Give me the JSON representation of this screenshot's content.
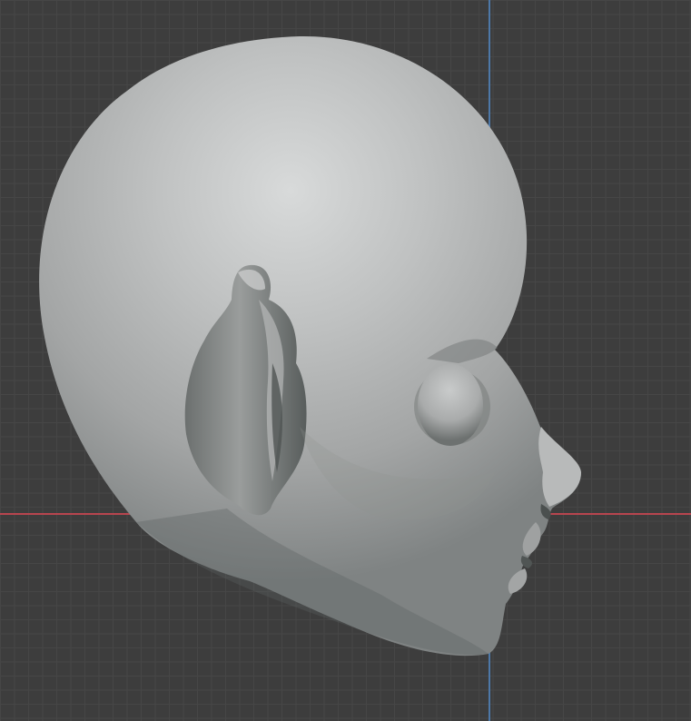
{
  "viewport": {
    "background_color": "#3d3d3d",
    "grid_minor_color": "#464646",
    "grid_major_color": "#4d4d4d",
    "x_axis_color": "#b7454f",
    "y_axis_color": "#4d78a8"
  },
  "model": {
    "object": "sculpted-head",
    "view": "side",
    "base_color": "#a9abab",
    "highlight_color": "#d8dada",
    "shadow_color": "#4c5150"
  }
}
